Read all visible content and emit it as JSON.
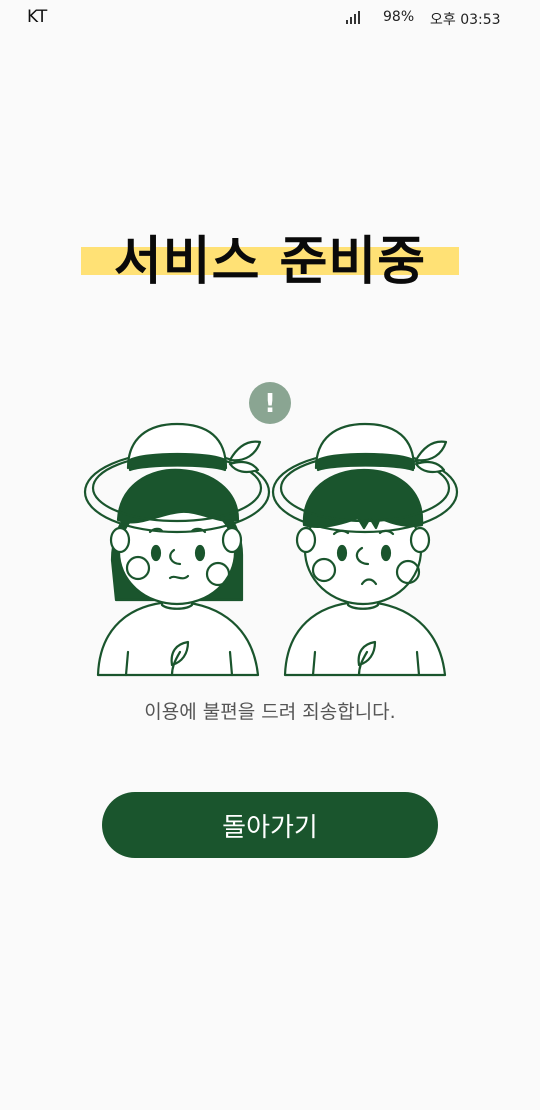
{
  "status_bar": {
    "carrier": "KT",
    "battery": "98%",
    "time": "오후 03:53"
  },
  "title": "서비스 준비중",
  "illustration": {
    "alert_mark": "!",
    "figures": [
      "woman-in-hat",
      "man-in-hat"
    ]
  },
  "message": "이용에 불편을 드려 죄송합니다.",
  "back_button_label": "돌아가기",
  "colors": {
    "brand_green": "#1a552d",
    "highlight_yellow": "#ffe175",
    "alert_gray_green": "#8aa592",
    "background": "#fafafa"
  },
  "icons": [
    "signal-icon",
    "alert-icon"
  ]
}
